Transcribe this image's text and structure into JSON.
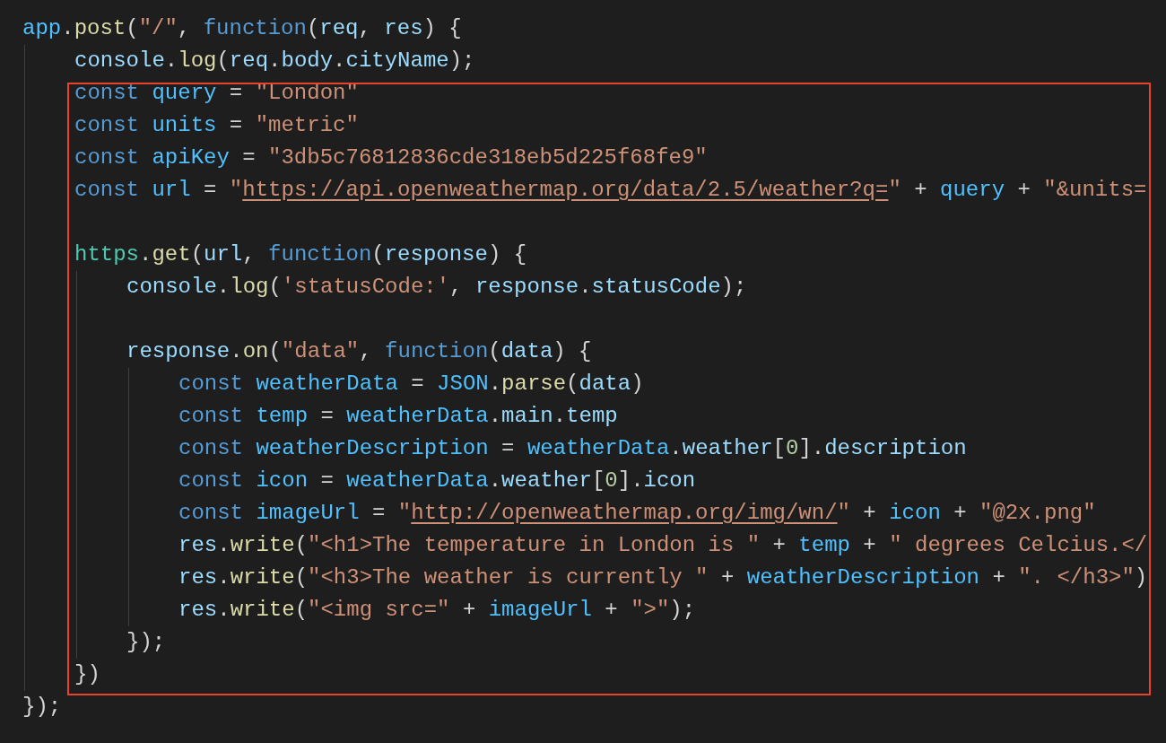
{
  "editor": {
    "lines": [
      {
        "kind": "code",
        "tokens": [
          {
            "kind": "var",
            "t": "app"
          },
          {
            "kind": "p",
            "t": "."
          },
          {
            "kind": "fn",
            "t": "post"
          },
          {
            "kind": "p",
            "t": "("
          },
          {
            "kind": "str",
            "t": "\"/\""
          },
          {
            "kind": "p",
            "t": ", "
          },
          {
            "kind": "kw",
            "t": "function"
          },
          {
            "kind": "p",
            "t": "("
          },
          {
            "kind": "prop",
            "t": "req"
          },
          {
            "kind": "p",
            "t": ", "
          },
          {
            "kind": "prop",
            "t": "res"
          },
          {
            "kind": "p",
            "t": ") {"
          }
        ],
        "children": [
          {
            "kind": "code",
            "tokens": [
              {
                "kind": "prop",
                "t": "console"
              },
              {
                "kind": "p",
                "t": "."
              },
              {
                "kind": "fn",
                "t": "log"
              },
              {
                "kind": "p",
                "t": "("
              },
              {
                "kind": "prop",
                "t": "req"
              },
              {
                "kind": "p",
                "t": "."
              },
              {
                "kind": "prop",
                "t": "body"
              },
              {
                "kind": "p",
                "t": "."
              },
              {
                "kind": "prop",
                "t": "cityName"
              },
              {
                "kind": "p",
                "t": ");"
              }
            ]
          },
          {
            "kind": "code",
            "tokens": [
              {
                "kind": "kw",
                "t": "const "
              },
              {
                "kind": "var",
                "t": "query"
              },
              {
                "kind": "p",
                "t": " = "
              },
              {
                "kind": "str",
                "t": "\"London\""
              }
            ]
          },
          {
            "kind": "code",
            "tokens": [
              {
                "kind": "kw",
                "t": "const "
              },
              {
                "kind": "var",
                "t": "units"
              },
              {
                "kind": "p",
                "t": " = "
              },
              {
                "kind": "str",
                "t": "\"metric\""
              }
            ]
          },
          {
            "kind": "code",
            "tokens": [
              {
                "kind": "kw",
                "t": "const "
              },
              {
                "kind": "var",
                "t": "apiKey"
              },
              {
                "kind": "p",
                "t": " = "
              },
              {
                "kind": "str",
                "t": "\"3db5c76812836cde318eb5d225f68fe9\""
              }
            ]
          },
          {
            "kind": "code",
            "tokens": [
              {
                "kind": "kw",
                "t": "const "
              },
              {
                "kind": "var",
                "t": "url"
              },
              {
                "kind": "p",
                "t": " = "
              },
              {
                "kind": "str",
                "t": "\""
              },
              {
                "kind": "url",
                "t": "https://api.openweathermap.org/data/2.5/weather?q="
              },
              {
                "kind": "str",
                "t": "\""
              },
              {
                "kind": "p",
                "t": " + "
              },
              {
                "kind": "var",
                "t": "query"
              },
              {
                "kind": "p",
                "t": " + "
              },
              {
                "kind": "str",
                "t": "\"&units="
              }
            ]
          },
          {
            "kind": "blank"
          },
          {
            "kind": "code",
            "tokens": [
              {
                "kind": "cls",
                "t": "https"
              },
              {
                "kind": "p",
                "t": "."
              },
              {
                "kind": "fn",
                "t": "get"
              },
              {
                "kind": "p",
                "t": "("
              },
              {
                "kind": "prop",
                "t": "url"
              },
              {
                "kind": "p",
                "t": ", "
              },
              {
                "kind": "kw",
                "t": "function"
              },
              {
                "kind": "p",
                "t": "("
              },
              {
                "kind": "prop",
                "t": "response"
              },
              {
                "kind": "p",
                "t": ") {"
              }
            ],
            "children": [
              {
                "kind": "code",
                "tokens": [
                  {
                    "kind": "prop",
                    "t": "console"
                  },
                  {
                    "kind": "p",
                    "t": "."
                  },
                  {
                    "kind": "fn",
                    "t": "log"
                  },
                  {
                    "kind": "p",
                    "t": "("
                  },
                  {
                    "kind": "str",
                    "t": "'statusCode:'"
                  },
                  {
                    "kind": "p",
                    "t": ", "
                  },
                  {
                    "kind": "prop",
                    "t": "response"
                  },
                  {
                    "kind": "p",
                    "t": "."
                  },
                  {
                    "kind": "prop",
                    "t": "statusCode"
                  },
                  {
                    "kind": "p",
                    "t": ");"
                  }
                ]
              },
              {
                "kind": "blank"
              },
              {
                "kind": "code",
                "tokens": [
                  {
                    "kind": "prop",
                    "t": "response"
                  },
                  {
                    "kind": "p",
                    "t": "."
                  },
                  {
                    "kind": "fn",
                    "t": "on"
                  },
                  {
                    "kind": "p",
                    "t": "("
                  },
                  {
                    "kind": "str",
                    "t": "\"data\""
                  },
                  {
                    "kind": "p",
                    "t": ", "
                  },
                  {
                    "kind": "kw",
                    "t": "function"
                  },
                  {
                    "kind": "p",
                    "t": "("
                  },
                  {
                    "kind": "prop",
                    "t": "data"
                  },
                  {
                    "kind": "p",
                    "t": ") {"
                  }
                ],
                "children": [
                  {
                    "kind": "code",
                    "tokens": [
                      {
                        "kind": "kw",
                        "t": "const "
                      },
                      {
                        "kind": "var",
                        "t": "weatherData"
                      },
                      {
                        "kind": "p",
                        "t": " = "
                      },
                      {
                        "kind": "var",
                        "t": "JSON"
                      },
                      {
                        "kind": "p",
                        "t": "."
                      },
                      {
                        "kind": "fn",
                        "t": "parse"
                      },
                      {
                        "kind": "p",
                        "t": "("
                      },
                      {
                        "kind": "prop",
                        "t": "data"
                      },
                      {
                        "kind": "p",
                        "t": ")"
                      }
                    ]
                  },
                  {
                    "kind": "code",
                    "tokens": [
                      {
                        "kind": "kw",
                        "t": "const "
                      },
                      {
                        "kind": "var",
                        "t": "temp"
                      },
                      {
                        "kind": "p",
                        "t": " = "
                      },
                      {
                        "kind": "var",
                        "t": "weatherData"
                      },
                      {
                        "kind": "p",
                        "t": "."
                      },
                      {
                        "kind": "prop",
                        "t": "main"
                      },
                      {
                        "kind": "p",
                        "t": "."
                      },
                      {
                        "kind": "prop",
                        "t": "temp"
                      }
                    ]
                  },
                  {
                    "kind": "code",
                    "tokens": [
                      {
                        "kind": "kw",
                        "t": "const "
                      },
                      {
                        "kind": "var",
                        "t": "weatherDescription"
                      },
                      {
                        "kind": "p",
                        "t": " = "
                      },
                      {
                        "kind": "var",
                        "t": "weatherData"
                      },
                      {
                        "kind": "p",
                        "t": "."
                      },
                      {
                        "kind": "prop",
                        "t": "weather"
                      },
                      {
                        "kind": "p",
                        "t": "["
                      },
                      {
                        "kind": "num",
                        "t": "0"
                      },
                      {
                        "kind": "p",
                        "t": "]."
                      },
                      {
                        "kind": "prop",
                        "t": "description"
                      }
                    ]
                  },
                  {
                    "kind": "code",
                    "tokens": [
                      {
                        "kind": "kw",
                        "t": "const "
                      },
                      {
                        "kind": "var",
                        "t": "icon"
                      },
                      {
                        "kind": "p",
                        "t": " = "
                      },
                      {
                        "kind": "var",
                        "t": "weatherData"
                      },
                      {
                        "kind": "p",
                        "t": "."
                      },
                      {
                        "kind": "prop",
                        "t": "weather"
                      },
                      {
                        "kind": "p",
                        "t": "["
                      },
                      {
                        "kind": "num",
                        "t": "0"
                      },
                      {
                        "kind": "p",
                        "t": "]."
                      },
                      {
                        "kind": "prop",
                        "t": "icon"
                      }
                    ]
                  },
                  {
                    "kind": "code",
                    "tokens": [
                      {
                        "kind": "kw",
                        "t": "const "
                      },
                      {
                        "kind": "var",
                        "t": "imageUrl"
                      },
                      {
                        "kind": "p",
                        "t": " = "
                      },
                      {
                        "kind": "str",
                        "t": "\""
                      },
                      {
                        "kind": "url",
                        "t": "http://openweathermap.org/img/wn/"
                      },
                      {
                        "kind": "str",
                        "t": "\""
                      },
                      {
                        "kind": "p",
                        "t": " + "
                      },
                      {
                        "kind": "var",
                        "t": "icon"
                      },
                      {
                        "kind": "p",
                        "t": " + "
                      },
                      {
                        "kind": "str",
                        "t": "\"@2x.png\""
                      }
                    ]
                  },
                  {
                    "kind": "code",
                    "tokens": [
                      {
                        "kind": "prop",
                        "t": "res"
                      },
                      {
                        "kind": "p",
                        "t": "."
                      },
                      {
                        "kind": "fn",
                        "t": "write"
                      },
                      {
                        "kind": "p",
                        "t": "("
                      },
                      {
                        "kind": "str",
                        "t": "\"<h1>The temperature in London is \""
                      },
                      {
                        "kind": "p",
                        "t": " + "
                      },
                      {
                        "kind": "var",
                        "t": "temp"
                      },
                      {
                        "kind": "p",
                        "t": " + "
                      },
                      {
                        "kind": "str",
                        "t": "\" degrees Celcius.</"
                      }
                    ]
                  },
                  {
                    "kind": "code",
                    "tokens": [
                      {
                        "kind": "prop",
                        "t": "res"
                      },
                      {
                        "kind": "p",
                        "t": "."
                      },
                      {
                        "kind": "fn",
                        "t": "write"
                      },
                      {
                        "kind": "p",
                        "t": "("
                      },
                      {
                        "kind": "str",
                        "t": "\"<h3>The weather is currently \""
                      },
                      {
                        "kind": "p",
                        "t": " + "
                      },
                      {
                        "kind": "var",
                        "t": "weatherDescription"
                      },
                      {
                        "kind": "p",
                        "t": " + "
                      },
                      {
                        "kind": "str",
                        "t": "\". </h3>\""
                      },
                      {
                        "kind": "p",
                        "t": ")"
                      }
                    ]
                  },
                  {
                    "kind": "code",
                    "tokens": [
                      {
                        "kind": "prop",
                        "t": "res"
                      },
                      {
                        "kind": "p",
                        "t": "."
                      },
                      {
                        "kind": "fn",
                        "t": "write"
                      },
                      {
                        "kind": "p",
                        "t": "("
                      },
                      {
                        "kind": "str",
                        "t": "\"<img src=\""
                      },
                      {
                        "kind": "p",
                        "t": " + "
                      },
                      {
                        "kind": "var",
                        "t": "imageUrl"
                      },
                      {
                        "kind": "p",
                        "t": " + "
                      },
                      {
                        "kind": "str",
                        "t": "\">\""
                      },
                      {
                        "kind": "p",
                        "t": ");"
                      }
                    ]
                  }
                ]
              },
              {
                "kind": "code",
                "tokens": [
                  {
                    "kind": "p",
                    "t": "});"
                  }
                ]
              }
            ]
          },
          {
            "kind": "code",
            "tokens": [
              {
                "kind": "p",
                "t": "})"
              }
            ]
          }
        ]
      },
      {
        "kind": "code",
        "tokens": [
          {
            "kind": "p",
            "t": "});"
          }
        ]
      }
    ]
  }
}
